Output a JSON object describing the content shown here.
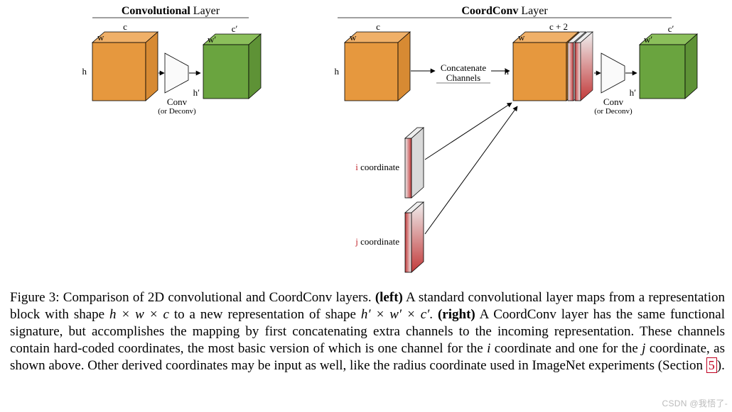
{
  "left": {
    "title_bold": "Convolutional",
    "title_rest": " Layer",
    "in_c": "c",
    "in_w": "w",
    "in_h": "h",
    "out_c": "c′",
    "out_w": "w′",
    "out_h": "h′",
    "op": "Conv",
    "op_sub": "(or Deconv)"
  },
  "right": {
    "title_bold": "CoordConv",
    "title_rest": " Layer",
    "in_c": "c",
    "in_w": "w",
    "in_h": "h",
    "mid_c": "c + 2",
    "mid_w": "w",
    "mid_h": "h",
    "out_c": "c′",
    "out_w": "w′",
    "out_h": "h′",
    "op": "Conv",
    "op_sub": "(or Deconv)",
    "concat1": "Concatenate",
    "concat2": "Channels",
    "coord_i_pre": "i",
    "coord_i_post": " coordinate",
    "coord_j_pre": "j",
    "coord_j_post": " coordinate"
  },
  "caption": {
    "fig": "Figure 3: Comparison of 2D convolutional and CoordConv layers. ",
    "left_bold": "(left)",
    "left_1": " A standard convolutional layer maps from a representation block with shape ",
    "shape_in": "h × w × c",
    "left_2": " to a new representation of shape ",
    "shape_out": "h′ × w′ × c′",
    "left_3": ". ",
    "right_bold": "(right)",
    "right_1": " A CoordConv layer has the same functional signature, but accomplishes the mapping by first concatenating extra channels to the incoming representation. These channels contain hard-coded coordinates, the most basic version of which is one channel for the ",
    "i": "i",
    "right_2": " coordinate and one for the ",
    "j": "j",
    "right_3": " coordinate, as shown above. Other derived coordinates may be input as well, like the radius coordinate used in ImageNet experiments (Section ",
    "section": "5",
    "right_4": ")."
  },
  "watermark": "CSDN @我悟了-"
}
